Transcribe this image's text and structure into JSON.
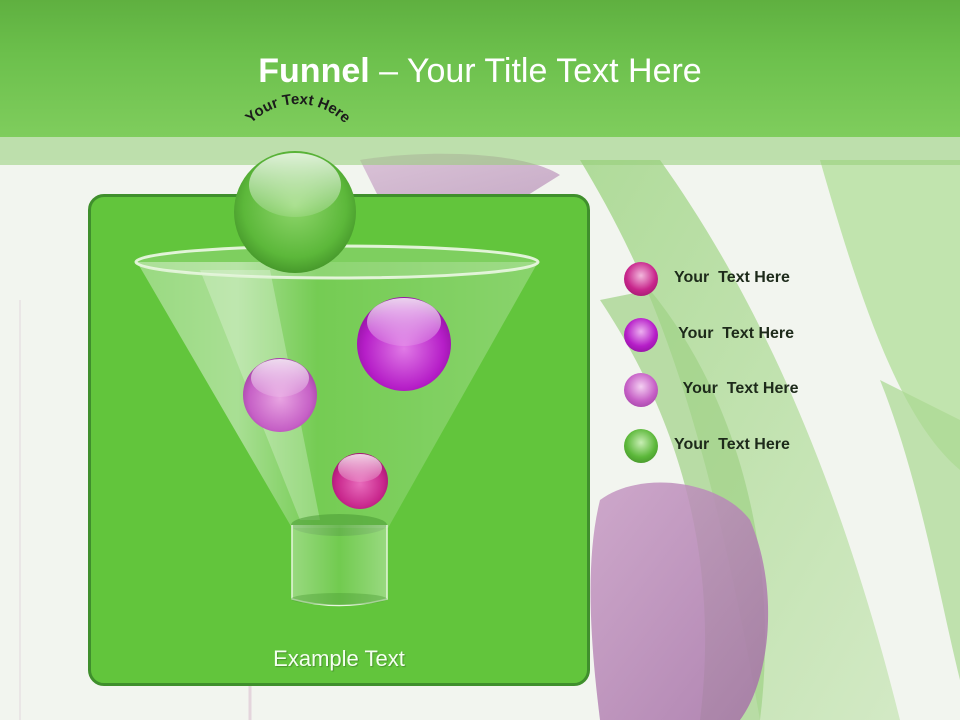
{
  "title": {
    "bold": "Funnel",
    "rest": " – Your Title Text Here"
  },
  "funnel": {
    "arc_text": "Your Text Here",
    "footer": "Example Text"
  },
  "legend": [
    {
      "label": "Your  Text Here",
      "color": "#c8268c"
    },
    {
      "label": " Your  Text Here",
      "color": "#b61ec8"
    },
    {
      "label": "  Your  Text Here",
      "color": "#c660c6"
    },
    {
      "label": "Your  Text Here",
      "color": "#5cb83a"
    }
  ],
  "colors": {
    "title_bar": "#6cc04c",
    "panel": "#62c53c",
    "panel_border": "#3f8f2c",
    "magenta": "#c8268c",
    "purple": "#b61ec8",
    "green_ball": "#5cb83a"
  }
}
